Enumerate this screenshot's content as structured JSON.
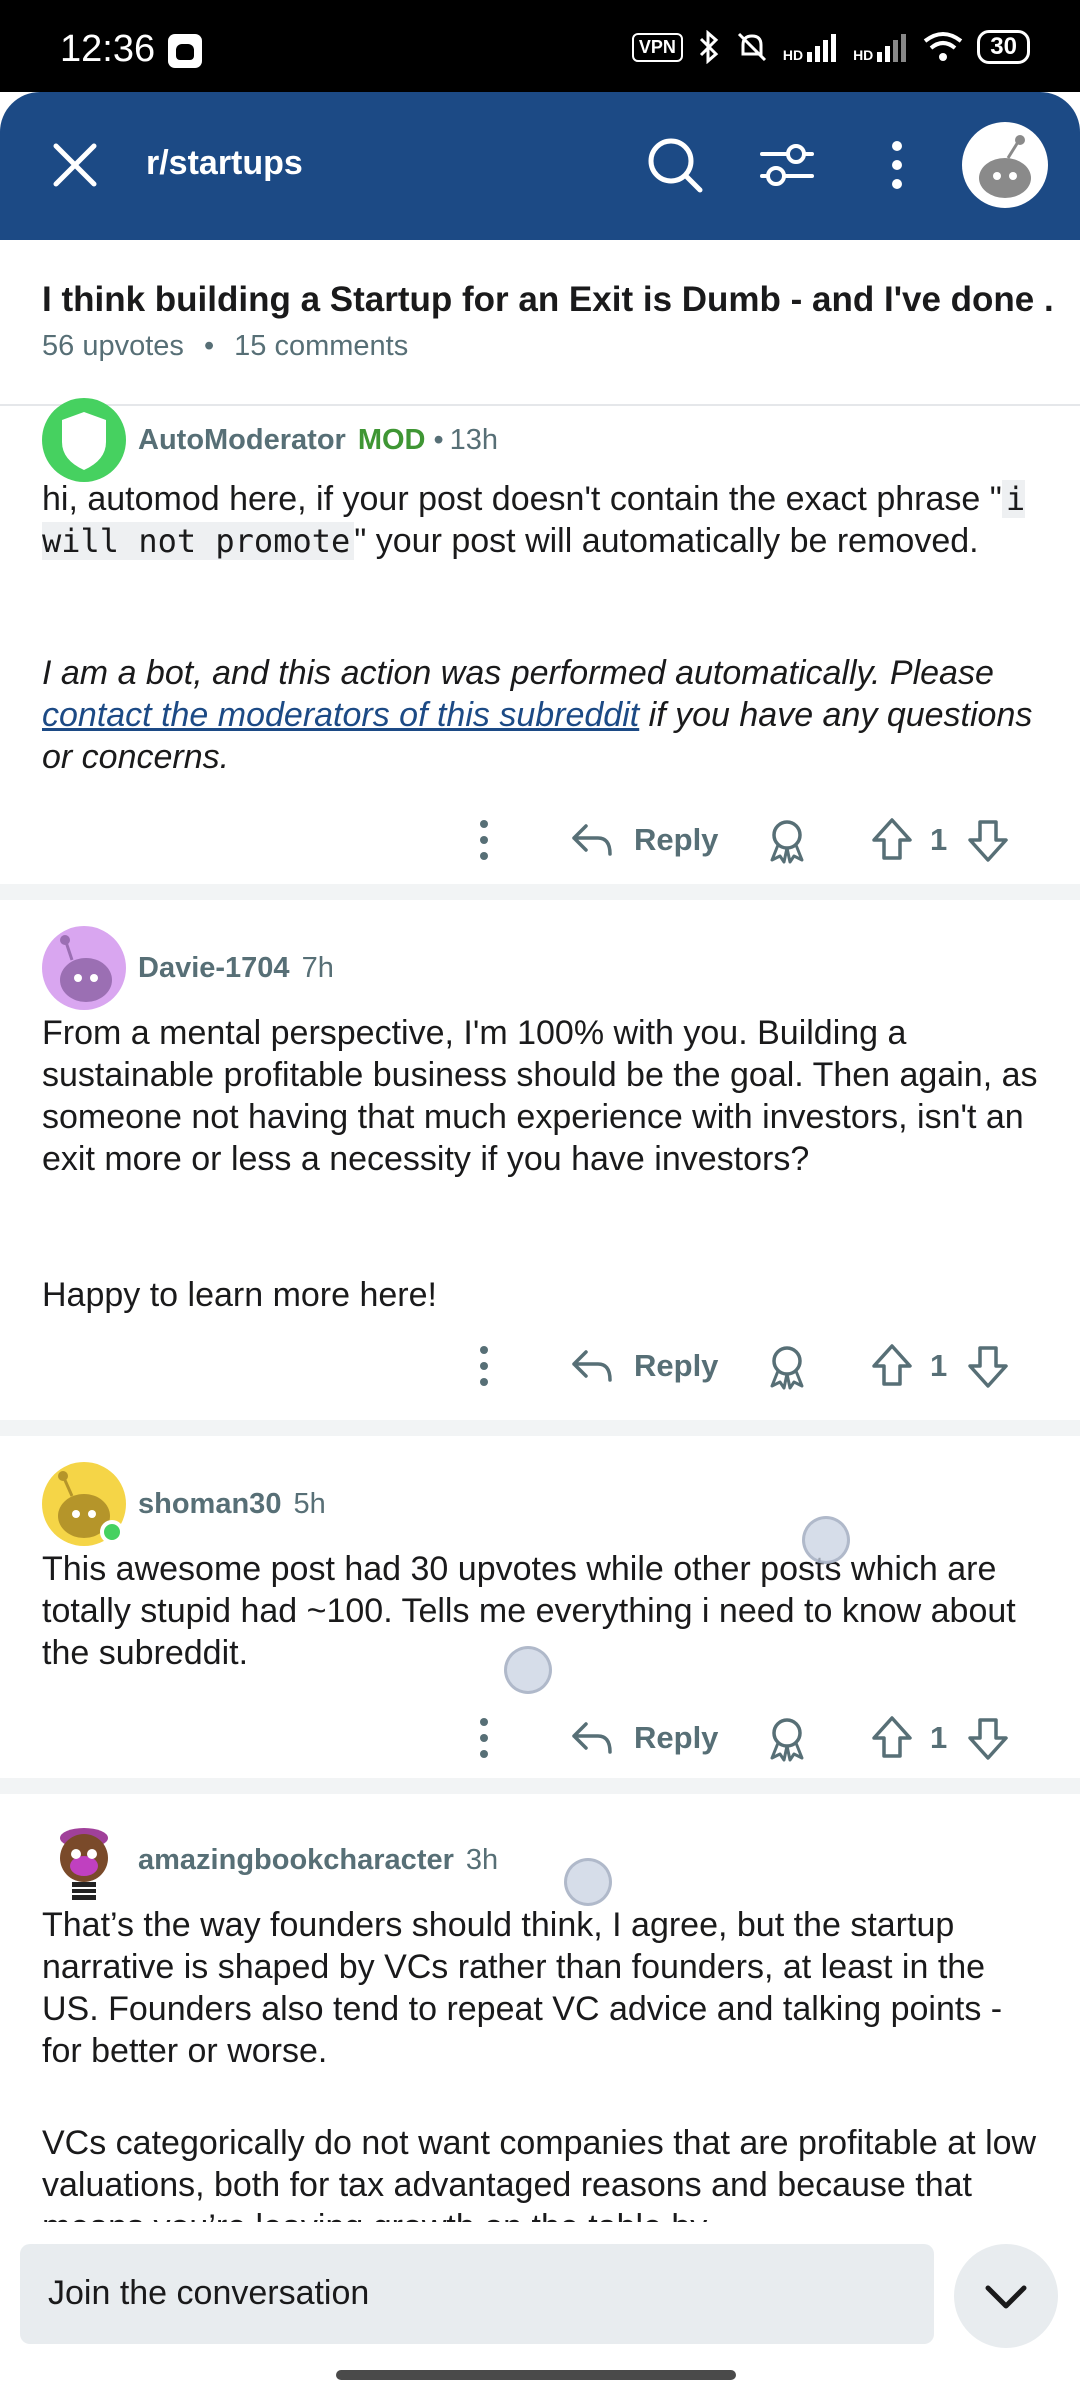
{
  "status_bar": {
    "time": "12:36",
    "vpn": "VPN",
    "signal1": "HD",
    "signal2": "HD",
    "battery": "30"
  },
  "header": {
    "subreddit": "r/startups",
    "icons": [
      "close-icon",
      "search-icon",
      "filter-icon",
      "more-vertical-icon",
      "avatar"
    ]
  },
  "post": {
    "title": "I think building a Startup for an Exit is Dumb - and I've done ...",
    "upvotes": "56 upvotes",
    "comments": "15 comments",
    "separator": "•"
  },
  "comments": [
    {
      "author": "AutoModerator",
      "badge": "MOD",
      "separator": "•",
      "time": "13h",
      "text_a": "hi, automod here, if your post doesn't contain the exact phrase \"",
      "text_code": "i will not promote",
      "text_b": "\" your post will automatically be removed.",
      "italic_a": "I am a bot, and this action was performed automatically. Please ",
      "italic_link": "contact the moderators of this subreddit",
      "italic_b": " if you have any questions or concerns.",
      "reply": "Reply",
      "score": "1"
    },
    {
      "author": "Davie-1704",
      "time": "7h",
      "text_p1": "From a mental perspective, I'm 100% with you. Building a sustainable profitable business should be the goal. Then again, as someone not having that much experience with investors, isn't an exit more or less a necessity if you have investors?",
      "text_p2": "Happy to learn more here!",
      "reply": "Reply",
      "score": "1"
    },
    {
      "author": "shoman30",
      "time": "5h",
      "text_p1": "This awesome post had 30 upvotes while other posts which are totally stupid had ~100. Tells me everything i need to know about the subreddit.",
      "reply": "Reply",
      "score": "1"
    },
    {
      "author": "amazingbookcharacter",
      "time": "3h",
      "text_p1": "That’s the way founders should think, I agree, but the startup narrative is shaped by VCs rather than founders, at least in the US. Founders also tend to repeat VC advice and talking points - for better or worse.",
      "text_p2": "VCs categorically do not want companies that are profitable at low valuations, both for tax advantaged reasons and because that means you’re leaving growth on the table by"
    }
  ],
  "footer": {
    "join_placeholder": "Join the conversation"
  },
  "colors": {
    "header_bg": "#1c4a85",
    "mod_green": "#3f9634",
    "meta_gray": "#576f76"
  }
}
